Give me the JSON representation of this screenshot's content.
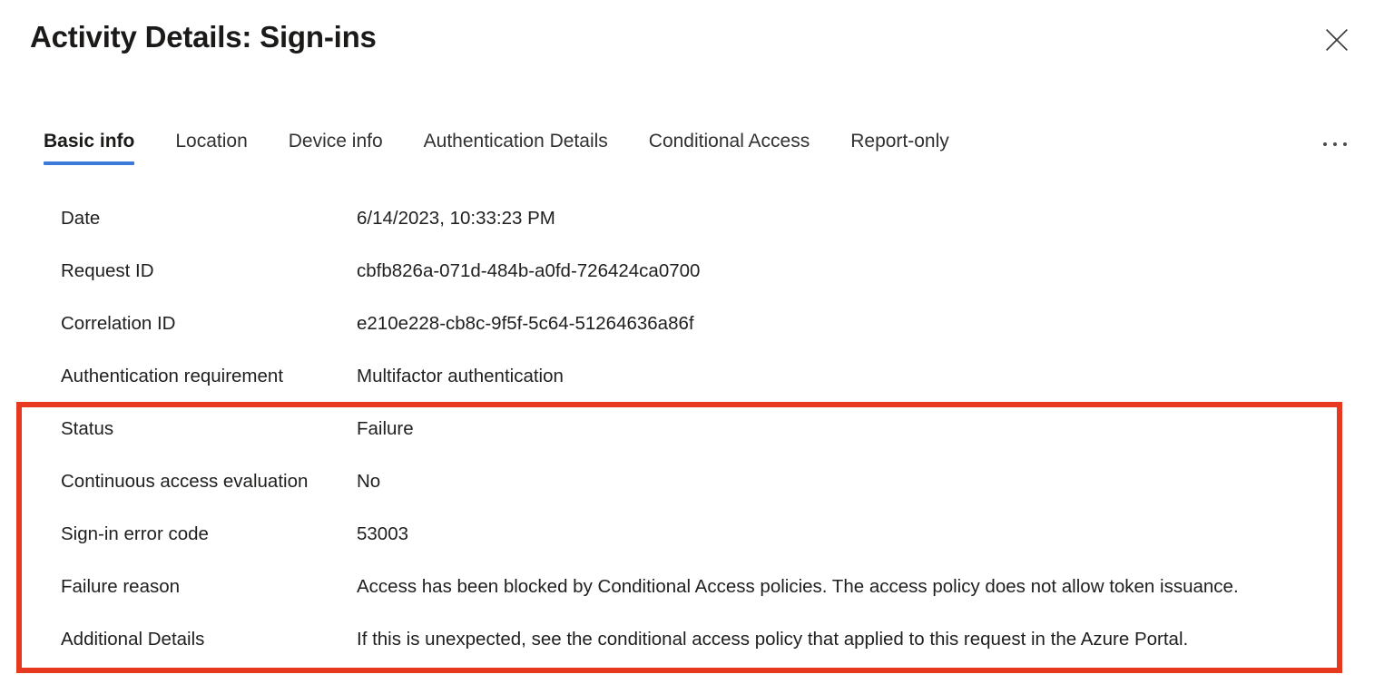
{
  "header": {
    "title": "Activity Details: Sign-ins",
    "close_icon": "close-icon",
    "close_label": "Close"
  },
  "tabs": {
    "items": [
      {
        "label": "Basic info",
        "selected": true
      },
      {
        "label": "Location",
        "selected": false
      },
      {
        "label": "Device info",
        "selected": false
      },
      {
        "label": "Authentication Details",
        "selected": false
      },
      {
        "label": "Conditional Access",
        "selected": false
      },
      {
        "label": "Report-only",
        "selected": false
      }
    ],
    "overflow_icon": "ellipsis-icon",
    "selected_underline_color": "#3b7ad9"
  },
  "details": {
    "rows": [
      {
        "label": "Date",
        "value": "6/14/2023, 10:33:23 PM",
        "highlighted": false
      },
      {
        "label": "Request ID",
        "value": "cbfb826a-071d-484b-a0fd-726424ca0700",
        "highlighted": false
      },
      {
        "label": "Correlation ID",
        "value": "e210e228-cb8c-9f5f-5c64-51264636a86f",
        "highlighted": false
      },
      {
        "label": "Authentication requirement",
        "value": "Multifactor authentication",
        "highlighted": false
      },
      {
        "label": "Status",
        "value": "Failure",
        "highlighted": true
      },
      {
        "label": "Continuous access evaluation",
        "value": "No",
        "highlighted": true
      },
      {
        "label": "Sign-in error code",
        "value": "53003",
        "highlighted": true
      },
      {
        "label": "Failure reason",
        "value": "Access has been blocked by Conditional Access policies. The access policy does not allow token issuance.",
        "highlighted": true
      },
      {
        "label": "Additional Details",
        "value": "If this is unexpected, see the conditional access policy that applied to this request in the Azure Portal.",
        "highlighted": true
      }
    ]
  },
  "annotation": {
    "highlight_color": "#e6391f",
    "highlight_description": "Red rectangle annotation around Status through Additional Details rows"
  }
}
